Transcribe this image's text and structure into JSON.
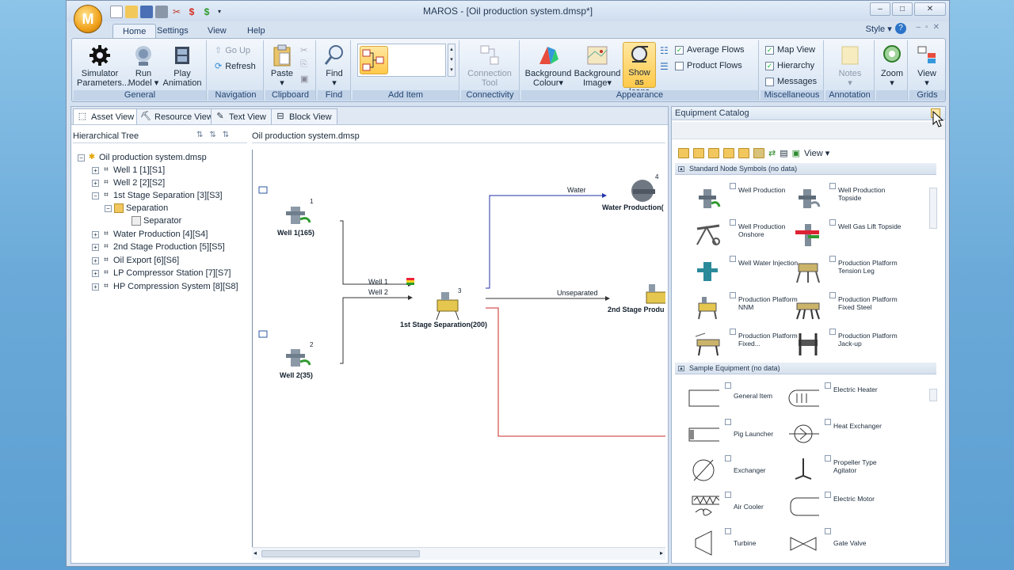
{
  "window": {
    "title": "MAROS - [Oil production system.dmsp*]",
    "app_letter": "M"
  },
  "ribbon_tabs": [
    "Home",
    "Settings",
    "View",
    "Help"
  ],
  "style_menu": "Style",
  "ribbon": {
    "general": {
      "label": "General",
      "simulator": "Simulator Parameters...",
      "run": "Run Model",
      "play": "Play Animation"
    },
    "navigation": {
      "label": "Navigation",
      "go_up": "Go Up",
      "refresh": "Refresh"
    },
    "clipboard": {
      "label": "Clipboard",
      "paste": "Paste"
    },
    "find": {
      "label": "Find",
      "find": "Find"
    },
    "add_item": {
      "label": "Add Item"
    },
    "connectivity": {
      "label": "Connectivity",
      "connection_tool": "Connection Tool"
    },
    "appearance": {
      "label": "Appearance",
      "bg_colour": "Background Colour",
      "bg_image": "Background Image",
      "show_icons": "Show as Icons",
      "average_flows": "Average Flows",
      "product_flows": "Product Flows"
    },
    "misc": {
      "label": "Miscellaneous",
      "map_view": "Map View",
      "hierarchy": "Hierarchy",
      "messages": "Messages"
    },
    "annotation": {
      "label": "Annotation",
      "notes": "Notes"
    },
    "zoom": {
      "zoom": "Zoom"
    },
    "grids": {
      "label": "Grids",
      "view": "View"
    }
  },
  "view_tabs": [
    "Asset View",
    "Resource View",
    "Text View",
    "Block View"
  ],
  "tree": {
    "header": "Hierarchical Tree",
    "doc_header": "Oil production system.dmsp",
    "nodes": [
      "Oil production system.dmsp",
      "Well 1 [1][S1]",
      "Well 2 [2][S2]",
      "1st Stage Separation [3][S3]",
      "Separation",
      "Separator",
      "Water Production [4][S4]",
      "2nd Stage Production [5][S5]",
      "Oil Export [6][S6]",
      "LP Compressor Station [7][S7]",
      "HP Compression System [8][S8]"
    ]
  },
  "diagram": {
    "well1_label": "Well 1(165)",
    "well1_num": "1",
    "well2_label": "Well 2(35)",
    "well2_num": "2",
    "sep_label": "1st Stage Separation(200)",
    "sep_num": "3",
    "water_label": "Water Production(",
    "water_num": "4",
    "stage2_label": "2nd Stage Produ",
    "flow_water": "Water",
    "flow_well1": "Well 1",
    "flow_well2": "Well 2",
    "flow_unseparated": "Unseparated"
  },
  "catalog": {
    "title": "Equipment Catalog",
    "view_label": "View",
    "section1": "Standard Node Symbols (no data)",
    "section2": "Sample Equipment (no data)",
    "symbols": [
      "Well Production",
      "Well Production Topside",
      "Well Production Onshore",
      "Well Gas Lift Topside",
      "Well Water Injection",
      "Production Platform Tension Leg",
      "Production Platform NNM",
      "Production Platform Fixed Steel",
      "Production Platform Fixed...",
      "Production Platform Jack-up"
    ],
    "equipment": [
      "General Item",
      "Electric Heater",
      "Pig Launcher",
      "Heat Exchanger",
      "Exchanger",
      "Propeller Type Agitator",
      "Air Cooler",
      "Electric Motor",
      "Turbine",
      "Gate Valve"
    ]
  }
}
